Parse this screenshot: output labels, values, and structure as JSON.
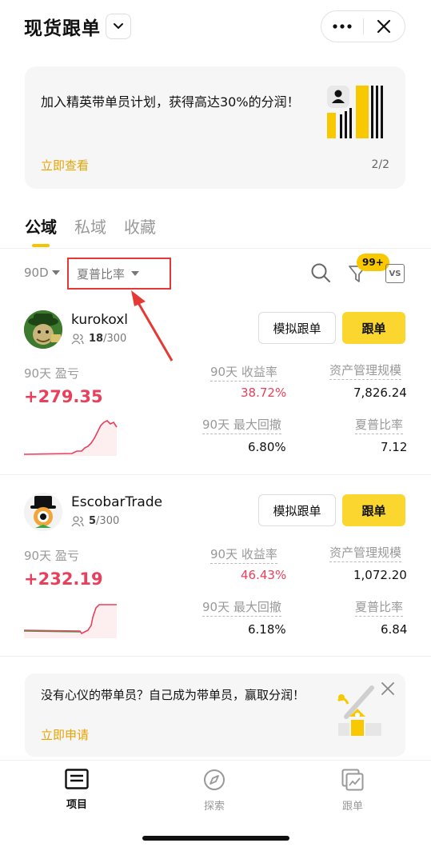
{
  "header": {
    "title": "现货跟单",
    "more_icon": "more-horizontal-icon",
    "close_icon": "close-icon"
  },
  "banner": {
    "text": "加入精英带单员计划，获得高达30%的分润！",
    "link": "立即查看",
    "page": "2/2"
  },
  "tabs": [
    {
      "label": "公域",
      "active": true
    },
    {
      "label": "私域",
      "active": false
    },
    {
      "label": "收藏",
      "active": false
    }
  ],
  "filters": {
    "period": "90D",
    "sort": "夏普比率",
    "badge": "99+",
    "vs": "VS"
  },
  "traders": [
    {
      "name": "kurokoxl",
      "followers_current": "18",
      "followers_max": "/300",
      "btn_sim": "模拟跟单",
      "btn_follow": "跟单",
      "pnl_label": "90天 盈亏",
      "pnl": "+279.35",
      "roi_label": "90天 收益率",
      "roi": "38.72%",
      "aum_label": "资产管理规模",
      "aum": "7,826.24",
      "mdd_label": "90天 最大回撤",
      "mdd": "6.80%",
      "sharpe_label": "夏普比率",
      "sharpe": "7.12"
    },
    {
      "name": "EscobarTrade",
      "followers_current": "5",
      "followers_max": "/300",
      "btn_sim": "模拟跟单",
      "btn_follow": "跟单",
      "pnl_label": "90天 盈亏",
      "pnl": "+232.19",
      "roi_label": "90天 收益率",
      "roi": "46.43%",
      "aum_label": "资产管理规模",
      "aum": "1,072.20",
      "mdd_label": "90天 最大回撤",
      "mdd": "6.18%",
      "sharpe_label": "夏普比率",
      "sharpe": "6.84"
    }
  ],
  "recruit": {
    "text": "没有心仪的带单员？自己成为带单员，赢取分润！",
    "link": "立即申请"
  },
  "bottom_nav": [
    {
      "label": "项目",
      "icon": "list-icon",
      "active": true
    },
    {
      "label": "探索",
      "icon": "compass-icon",
      "active": false
    },
    {
      "label": "跟单",
      "icon": "chart-icon",
      "active": false
    }
  ],
  "colors": {
    "accent": "#fad62e",
    "profit": "#ea3f5a",
    "link": "#e8a400",
    "highlight_box": "#e53935"
  }
}
